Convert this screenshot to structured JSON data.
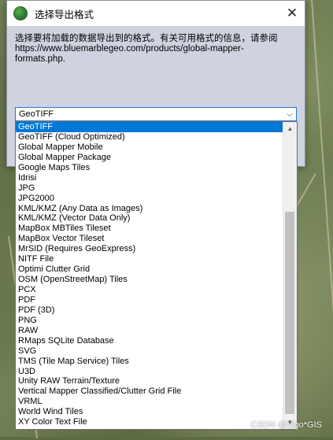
{
  "dialog": {
    "title": "选择导出格式",
    "instruction": "选择要将加载的数据导出到的格式。有关可用格式的信息，请参阅",
    "url": "https://www.bluemarblegeo.com/products/global-mapper-formats.php.",
    "close_glyph": "✕",
    "selected_value": "GeoTIFF",
    "dropdown_arrow": "⌵"
  },
  "formats": [
    "GeoTIFF",
    "GeoTIFF (Cloud Optimized)",
    "Global Mapper Mobile",
    "Global Mapper Package",
    "Google Maps Tiles",
    "Idrisi",
    "JPG",
    "JPG2000",
    "KML/KMZ (Any Data as Images)",
    "KML/KMZ (Vector Data Only)",
    "MapBox MBTiles Tileset",
    "MapBox Vector Tileset",
    "MrSID (Requires GeoExpress)",
    "NITF File",
    "Optimi Clutter Grid",
    "OSM (OpenStreetMap) Tiles",
    "PCX",
    "PDF",
    "PDF (3D)",
    "PNG",
    "RAW",
    "RMaps SQLite Database",
    "SVG",
    "TMS (Tile Map Service) Tiles",
    "U3D",
    "Unity RAW Terrain/Texture",
    "Vertical Mapper Classified/Clutter Grid File",
    "VRML",
    "World Wind Tiles",
    "XY Color Text File"
  ],
  "selected_index": 0,
  "scrollbar": {
    "up_glyph": "▲",
    "down_glyph": "▼"
  },
  "watermark": "CSDN @Vigo*GIS",
  "colors": {
    "selection": "#0078d7",
    "dialog_bg": "#ced3df",
    "combo_border": "#2a78c9"
  }
}
